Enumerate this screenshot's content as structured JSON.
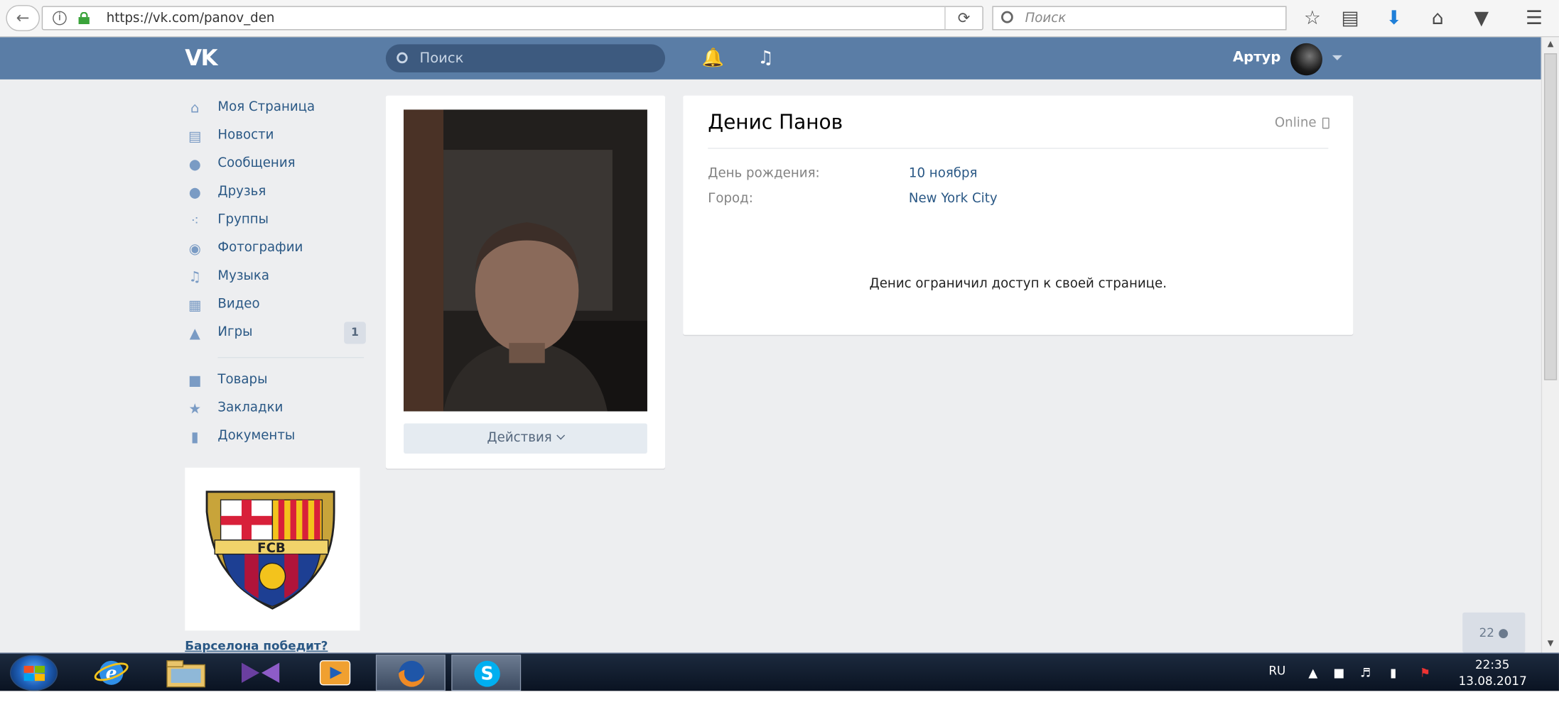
{
  "browser": {
    "url": "https://vk.com/panov_den",
    "search_placeholder": "Поиск"
  },
  "vk_header": {
    "logo": "VK",
    "search_placeholder": "Поиск",
    "user_name": "Артур"
  },
  "sidebar": {
    "items": [
      {
        "label": "Моя Страница",
        "icon": "home-icon"
      },
      {
        "label": "Новости",
        "icon": "news-icon"
      },
      {
        "label": "Сообщения",
        "icon": "messages-icon"
      },
      {
        "label": "Друзья",
        "icon": "friends-icon"
      },
      {
        "label": "Группы",
        "icon": "groups-icon"
      },
      {
        "label": "Фотографии",
        "icon": "camera-icon"
      },
      {
        "label": "Музыка",
        "icon": "music-icon"
      },
      {
        "label": "Видео",
        "icon": "video-icon"
      },
      {
        "label": "Игры",
        "icon": "gamepad-icon",
        "badge": "1"
      }
    ],
    "items2": [
      {
        "label": "Товары",
        "icon": "bag-icon"
      },
      {
        "label": "Закладки",
        "icon": "star-icon"
      },
      {
        "label": "Документы",
        "icon": "document-icon"
      }
    ],
    "ad": {
      "logo_text": "FCB",
      "title": "Барселона победит?"
    }
  },
  "profile": {
    "actions_label": "Действия",
    "name": "Денис Панов",
    "status": "Online",
    "fields": [
      {
        "label": "День рождения:",
        "value": "10 ноября"
      },
      {
        "label": "Город:",
        "value": "New York City"
      }
    ],
    "restricted_message": "Денис ограничил доступ к своей странице."
  },
  "online_counter": "22",
  "taskbar": {
    "language": "RU",
    "time": "22:35",
    "date": "13.08.2017"
  },
  "colors": {
    "vk_header": "#5a7da6",
    "vk_link": "#2a5885",
    "page_bg": "#edeef0"
  }
}
